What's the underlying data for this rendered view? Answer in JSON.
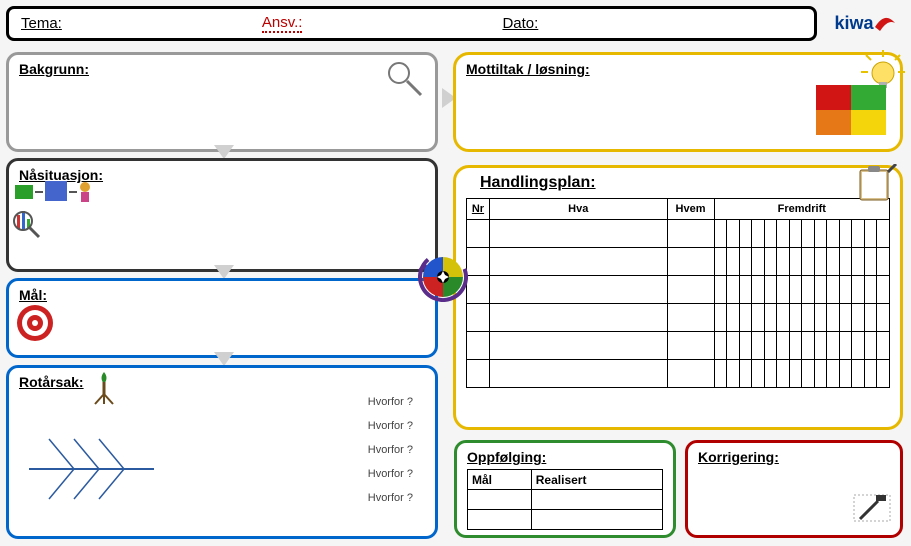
{
  "header": {
    "tema": "Tema:",
    "ansv": "Ansv.:",
    "dato": "Dato:",
    "brand": "kiwa"
  },
  "panels": {
    "bakgrunn": "Bakgrunn:",
    "nasituasjon": "Nåsituasjon:",
    "mal": "Mål:",
    "rotarsak": "Rotårsak:",
    "mottiltak": "Mottiltak / løsning:",
    "handlingsplan": "Handlingsplan:",
    "oppfolging": "Oppfølging:",
    "korrigering": "Korrigering:"
  },
  "handlingsplan": {
    "cols": {
      "nr": "Nr",
      "hva": "Hva",
      "hvem": "Hvem",
      "fremdrift": "Fremdrift"
    },
    "progress_cols": 14,
    "rows": 6
  },
  "oppfolging": {
    "cols": {
      "mal": "Mål",
      "realisert": "Realisert"
    },
    "rows": 2
  },
  "rotarsak": {
    "hvorfor": [
      "Hvorfor ?",
      "Hvorfor ?",
      "Hvorfor ?",
      "Hvorfor ?",
      "Hvorfor ?"
    ]
  },
  "colors": {
    "header_border": "#000000",
    "grey": "#999999",
    "dark": "#333333",
    "blue": "#0066cc",
    "yellow": "#e6b800",
    "green": "#2e8b2e",
    "red": "#b00000"
  }
}
